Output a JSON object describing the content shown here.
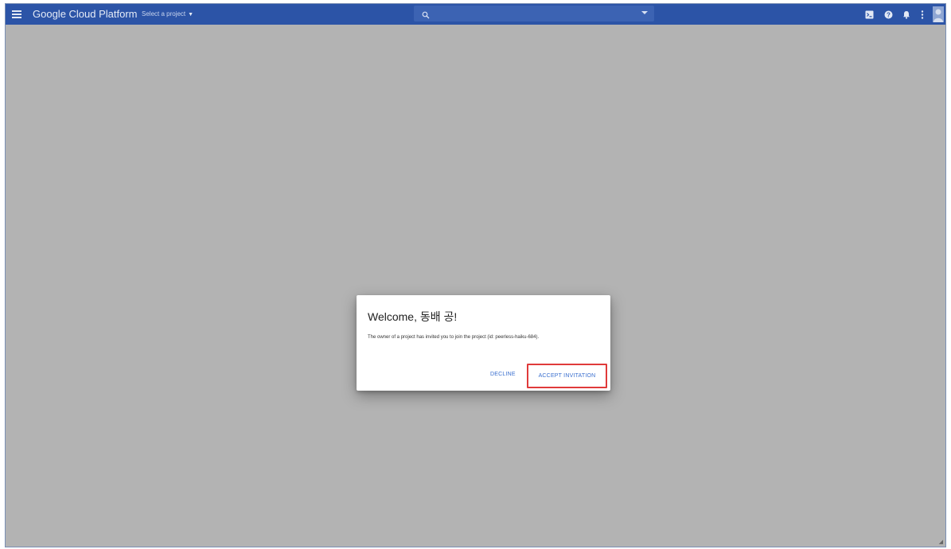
{
  "topbar": {
    "app_title": "Google Cloud Platform",
    "project_select": "Select a project",
    "search_placeholder": "",
    "color": "#2c54a7",
    "icons": [
      "menu-icon",
      "search-icon",
      "cloud-shell-icon",
      "help-icon",
      "notifications-icon",
      "more-vert-icon",
      "avatar"
    ]
  },
  "dialog": {
    "title": "Welcome, 동배 공!",
    "body": "The owner of a project has invited you to join the project (id: peerless-haiku-684).",
    "decline_label": "DECLINE",
    "accept_label": "ACCEPT INVITATION",
    "highlight_color": "#e03a3a"
  }
}
